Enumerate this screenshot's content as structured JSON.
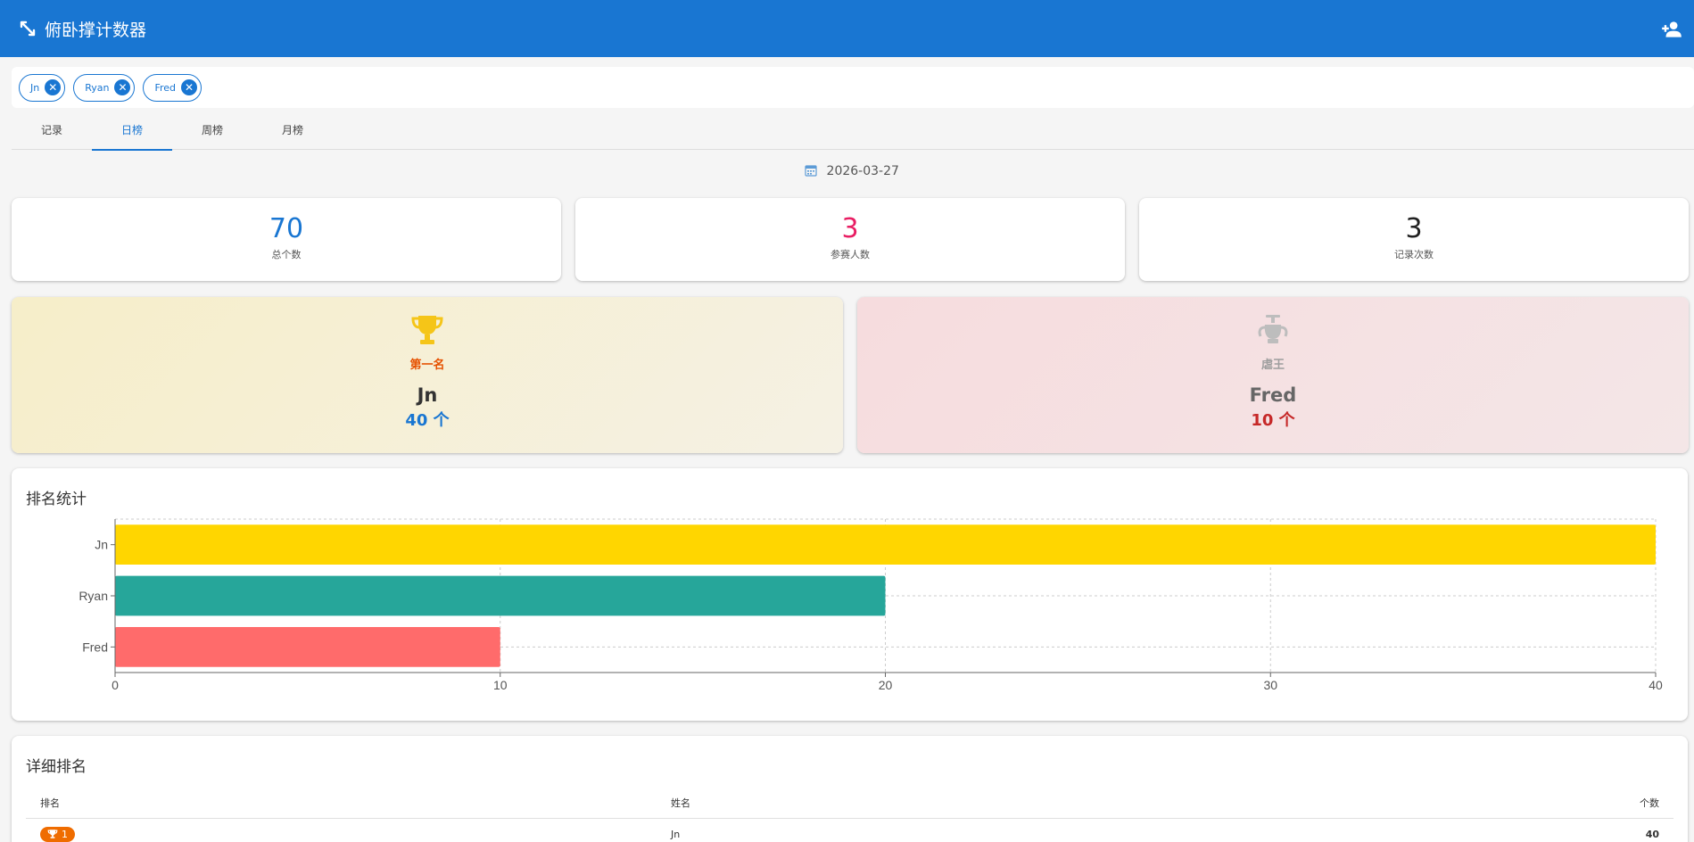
{
  "app": {
    "title": "俯卧撑计数器"
  },
  "participants": [
    "Jn",
    "Ryan",
    "Fred"
  ],
  "tabs": [
    {
      "label": "记录",
      "active": false
    },
    {
      "label": "日榜",
      "active": true
    },
    {
      "label": "周榜",
      "active": false
    },
    {
      "label": "月榜",
      "active": false
    }
  ],
  "date": "2026-03-27",
  "stats": [
    {
      "value": "70",
      "label": "总个数",
      "color": "#1976d2"
    },
    {
      "value": "3",
      "label": "参赛人数",
      "color": "#e91e63"
    },
    {
      "value": "3",
      "label": "记录次数",
      "color": "#212121"
    }
  ],
  "champion": {
    "rank_label": "第一名",
    "name": "Jn",
    "count": "40 个",
    "trophy_color": "#f5c518",
    "label_color": "#e65100",
    "count_color": "#1976d2"
  },
  "loser": {
    "rank_label": "虐王",
    "name": "Fred",
    "count": "10 个",
    "icon_color": "#bdbdbd",
    "label_color": "#9e9e9e",
    "count_color": "#c62828"
  },
  "ranking_chart": {
    "title": "排名统计"
  },
  "chart_data": {
    "type": "bar",
    "orientation": "horizontal",
    "categories": [
      "Jn",
      "Ryan",
      "Fred"
    ],
    "values": [
      40,
      20,
      10
    ],
    "colors": [
      "#ffd600",
      "#26a69a",
      "#ff6b6b"
    ],
    "xlim": [
      0,
      40
    ],
    "xticks": [
      0,
      10,
      20,
      30,
      40
    ],
    "grid": true
  },
  "detail": {
    "title": "详细排名",
    "columns": [
      "排名",
      "姓名",
      "个数"
    ],
    "rows": [
      {
        "rank": "1",
        "name": "Jn",
        "count": "40"
      }
    ]
  }
}
